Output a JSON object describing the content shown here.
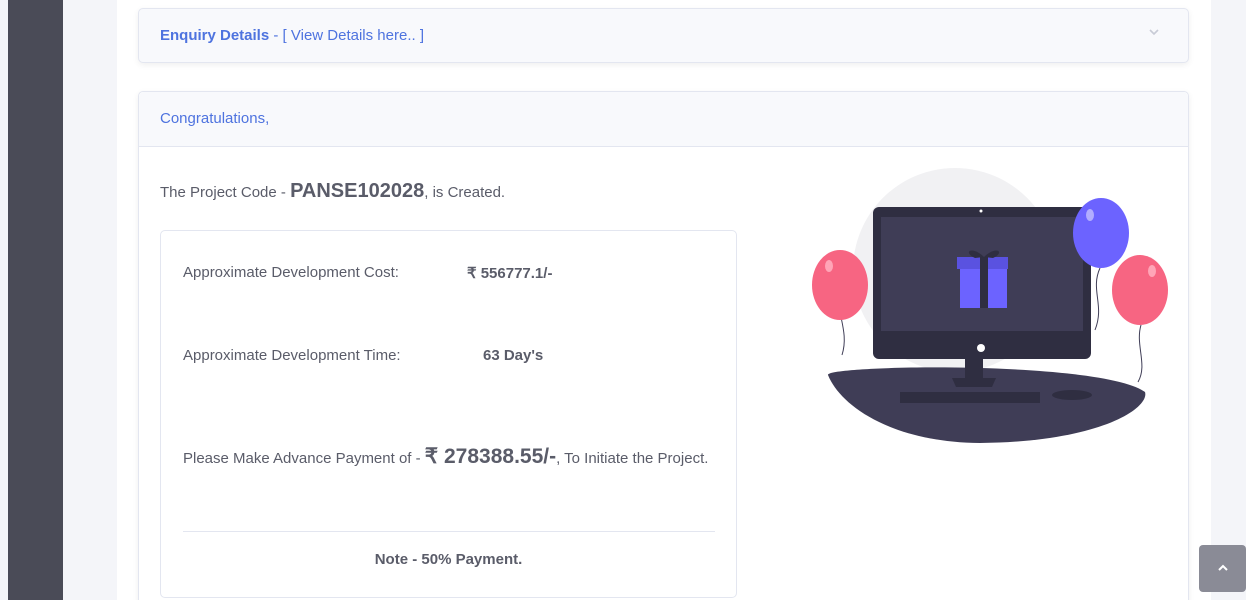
{
  "enquiry": {
    "title": "Enquiry Details",
    "separator": " - ",
    "link": "[ View Details here.. ]",
    "toggle_icon": "chevron-down-icon"
  },
  "result": {
    "header": "Congratulations,",
    "project_prefix": "The Project Code - ",
    "project_code": "PANSE102028",
    "project_suffix": ", is Created.",
    "cost_label": "Approximate Development Cost:",
    "cost_value": "₹ 556777.1/-",
    "time_label": "Approximate Development Time:",
    "time_value": "63 Day's",
    "payment_prefix": "Please Make Advance Payment of - ",
    "payment_amount": "₹ 278388.55/-",
    "payment_suffix": ", To Initiate the Project.",
    "note": "Note - 50% Payment."
  },
  "scroll_top": {
    "icon": "chevron-up-icon"
  },
  "colors": {
    "primary": "#4e73df",
    "sidebar": "#4a4b57",
    "text": "#5a5c69",
    "balloon_pink": "#f76582",
    "balloon_purple": "#6c63ff"
  }
}
